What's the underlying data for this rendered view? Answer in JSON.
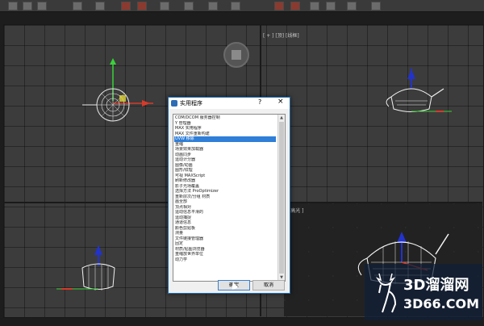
{
  "viewport_top_right_label": "[ + ] [顶] [线框]",
  "viewport_perspective_label": "[ 高光 ]",
  "dialog": {
    "title": "实用程序",
    "help": "?",
    "close": "×",
    "items": [
      "COM/DCOM 服务器控制",
      "Y 管理器",
      "MAX 实用程序",
      "MAX 文件重新构建",
      "UVW 移除",
      "重缩",
      "场景效果加载器",
      "动画同步",
      "运动计分器",
      "图像/动画",
      "图形/纹理",
      "可视 MAXScript",
      "刷新修改器",
      "影子光场覆盖",
      "选择方法 ProOptimizer",
      "重新层次/分组 材质",
      "画全部",
      "顶点相对",
      "运动信息平滑的",
      "运动捕捉",
      "通道信息",
      "颜色剪贴板",
      "测量",
      "文件链接管理器",
      "固定",
      "材质/贴图浏览器",
      "重缩放世界单位",
      "动力学"
    ],
    "selected_index": 4,
    "ok_label": "确定",
    "cancel_label": "取消"
  },
  "watermark": {
    "name": "3D溜溜网",
    "url": "3D66.COM"
  },
  "colors": {
    "selection": "#2f7ed8",
    "viewport": "#3c3c3c",
    "watermark_bg": "#0f1e37"
  }
}
